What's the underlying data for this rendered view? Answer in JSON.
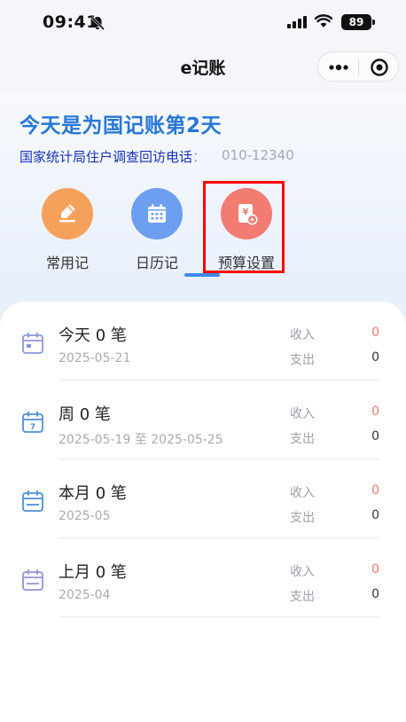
{
  "status_bar": {
    "time": "09:41",
    "battery": "89"
  },
  "nav": {
    "title": "e记账"
  },
  "banner": {
    "headline": "今天是为国记账第2天",
    "hotline_label": "国家统计局住户调查回访电话",
    "hotline_sep": "：",
    "hotline_number": "010-12340"
  },
  "shortcuts": [
    {
      "label": "常用记",
      "icon": "pencil-icon",
      "color": "#f5a15c"
    },
    {
      "label": "日历记",
      "icon": "calendar-icon",
      "color": "#6d9ff0"
    },
    {
      "label": "预算设置",
      "icon": "budget-icon",
      "color": "#f27b72"
    }
  ],
  "summary": {
    "income_label": "收入",
    "expense_label": "支出",
    "rows": [
      {
        "title": "今天 0 笔",
        "date": "2025-05-21",
        "income": "0",
        "expense": "0"
      },
      {
        "title": "周 0 笔",
        "date": "2025-05-19 至 2025-05-25",
        "income": "0",
        "expense": "0"
      },
      {
        "title": "本月 0 笔",
        "date": "2025-05",
        "income": "0",
        "expense": "0"
      },
      {
        "title": "上月 0 笔",
        "date": "2025-04",
        "income": "0",
        "expense": "0"
      }
    ]
  },
  "colors": {
    "accent": "#2777d6",
    "income": "#f07a6e",
    "highlight": "#ff0000"
  }
}
